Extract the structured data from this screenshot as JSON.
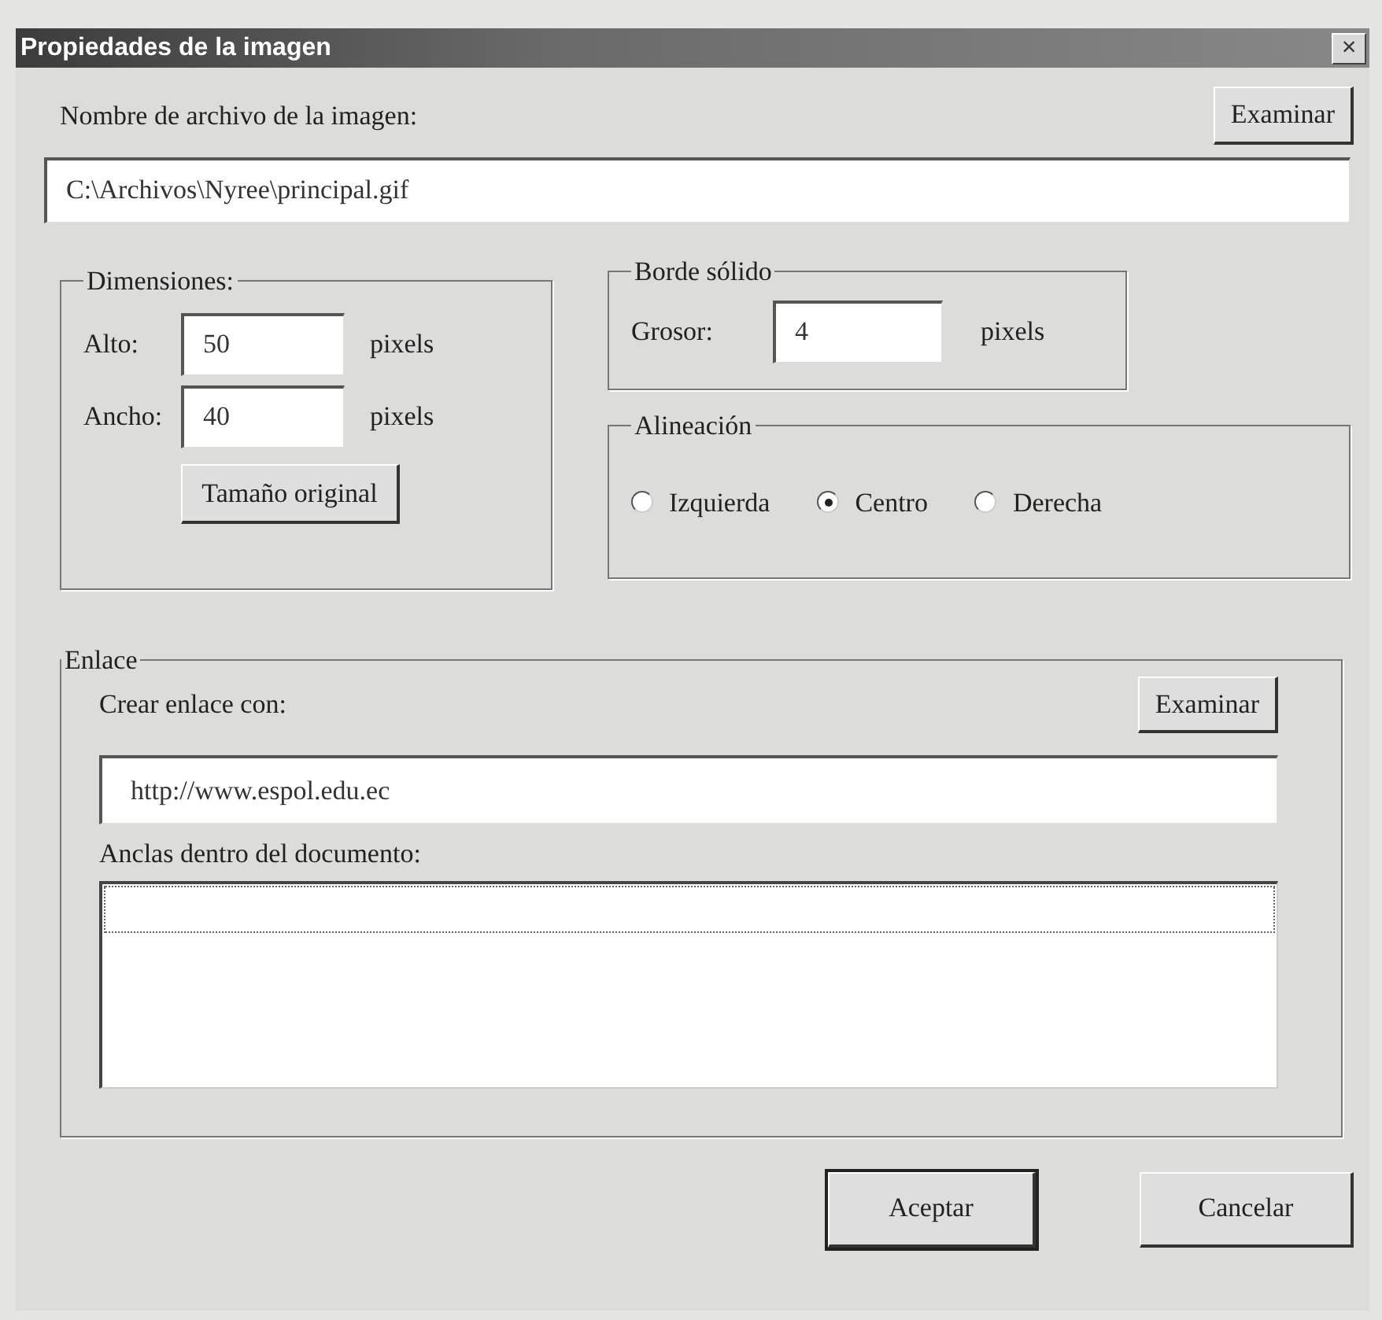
{
  "window": {
    "title": "Propiedades de la imagen",
    "close": "×"
  },
  "image_file": {
    "label": "Nombre de archivo de la imagen:",
    "browse_button": "Examinar",
    "value": "C:\\Archivos\\Nyree\\principal.gif"
  },
  "dimensions": {
    "legend": "Dimensiones:",
    "rows": [
      {
        "label": "Alto:",
        "value": "50",
        "unit": "pixels"
      },
      {
        "label": "Ancho:",
        "value": "40",
        "unit": "pixels"
      }
    ],
    "button": "Tamaño original"
  },
  "border": {
    "legend": "Borde sólido",
    "label": "Grosor:",
    "value": "4",
    "unit": "pixels"
  },
  "alignment": {
    "legend": "Alineación",
    "options": [
      {
        "label": "Izquierda",
        "selected": false
      },
      {
        "label": "Centro",
        "selected": true
      },
      {
        "label": "Derecha",
        "selected": false
      }
    ]
  },
  "link": {
    "legend": "Enlace",
    "label": "Crear enlace con:",
    "browse_button": "Examinar",
    "value": "http://www.espol.edu.ec",
    "anchors_label": "Anclas dentro del documento:"
  },
  "buttons": [
    {
      "label": "Aceptar",
      "default": true
    },
    {
      "label": "Cancelar",
      "default": false
    }
  ]
}
